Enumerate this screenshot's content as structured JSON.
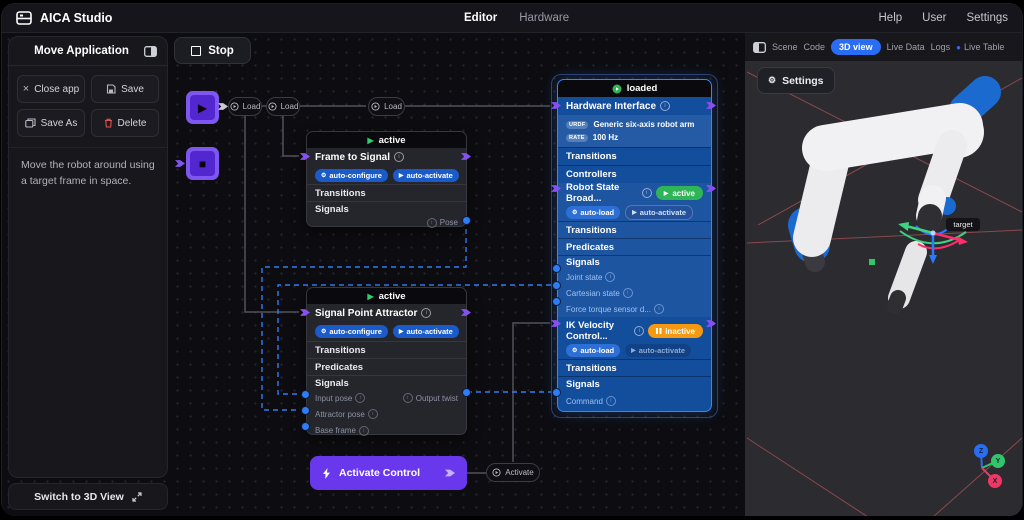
{
  "app": {
    "title": "AICA Studio",
    "nav": {
      "editor": "Editor",
      "hardware": "Hardware"
    },
    "right_nav": {
      "help": "Help",
      "user": "User",
      "settings": "Settings"
    }
  },
  "toolbar": {
    "stop_label": "Stop"
  },
  "sidebar": {
    "title": "Move Application",
    "buttons": {
      "close": "Close app",
      "save": "Save",
      "save_as": "Save As",
      "delete": "Delete"
    },
    "description": "Move the robot around using a target frame in space.",
    "switch_view": "Switch to 3D View"
  },
  "graph": {
    "pills": {
      "load1": "Load",
      "load2": "Load",
      "load3": "Load",
      "activate": "Activate"
    },
    "activate_button": "Activate Control",
    "frame_to_signal": {
      "status": "active",
      "title": "Frame to Signal",
      "badge_configure": "auto-configure",
      "badge_activate": "auto-activate",
      "transitions": "Transitions",
      "signals": "Signals",
      "pose": "Pose"
    },
    "signal_point_attractor": {
      "status": "active",
      "title": "Signal Point Attractor",
      "badge_configure": "auto-configure",
      "badge_activate": "auto-activate",
      "transitions": "Transitions",
      "predicates": "Predicates",
      "signals": "Signals",
      "input_pose": "Input pose",
      "attractor_pose": "Attractor pose",
      "base_frame": "Base frame",
      "output_twist": "Output twist"
    },
    "hardware_interface": {
      "status": "loaded",
      "title": "Hardware Interface",
      "urdf_tag": "URDF",
      "urdf_value": "Generic six-axis robot arm",
      "rate_tag": "RATE",
      "rate_value": "100 Hz",
      "transitions": "Transitions",
      "controllers": "Controllers"
    },
    "robot_state_broadcaster": {
      "title": "Robot State Broad...",
      "status": "active",
      "badge_load": "auto-load",
      "badge_activate": "auto-activate",
      "transitions": "Transitions",
      "predicates": "Predicates",
      "signals": "Signals",
      "joint_state": "Joint state",
      "cartesian_state": "Cartesian state",
      "force_torque": "Force torque sensor d..."
    },
    "ik_velocity_controller": {
      "title": "IK Velocity Control...",
      "status": "inactive",
      "badge_load": "auto-load",
      "badge_activate": "auto-activate",
      "transitions": "Transitions",
      "signals": "Signals",
      "command": "Command"
    }
  },
  "right_panel": {
    "tabs": {
      "scene": "Scene",
      "code": "Code",
      "view3d": "3D view",
      "live_data": "Live Data",
      "logs": "Logs",
      "live_table": "Live Table"
    },
    "active_tab": "3D view",
    "settings": "Settings",
    "viewport": {
      "target_label": "target",
      "axis_x": "X",
      "axis_y": "Y",
      "axis_z": "Z"
    }
  },
  "icons": {
    "play": "▶",
    "stop_square": "■",
    "gear": "⚙",
    "info": "i",
    "dot": "●",
    "close": "×"
  },
  "colors": {
    "accent_purple": "#6a38ec",
    "node_blue": "#134e9d",
    "active_green": "#2fb457",
    "inactive_orange": "#f59812",
    "port_blue": "#2f7df6",
    "tab_blue": "#2a6df5",
    "grid_red": "#b25757"
  }
}
